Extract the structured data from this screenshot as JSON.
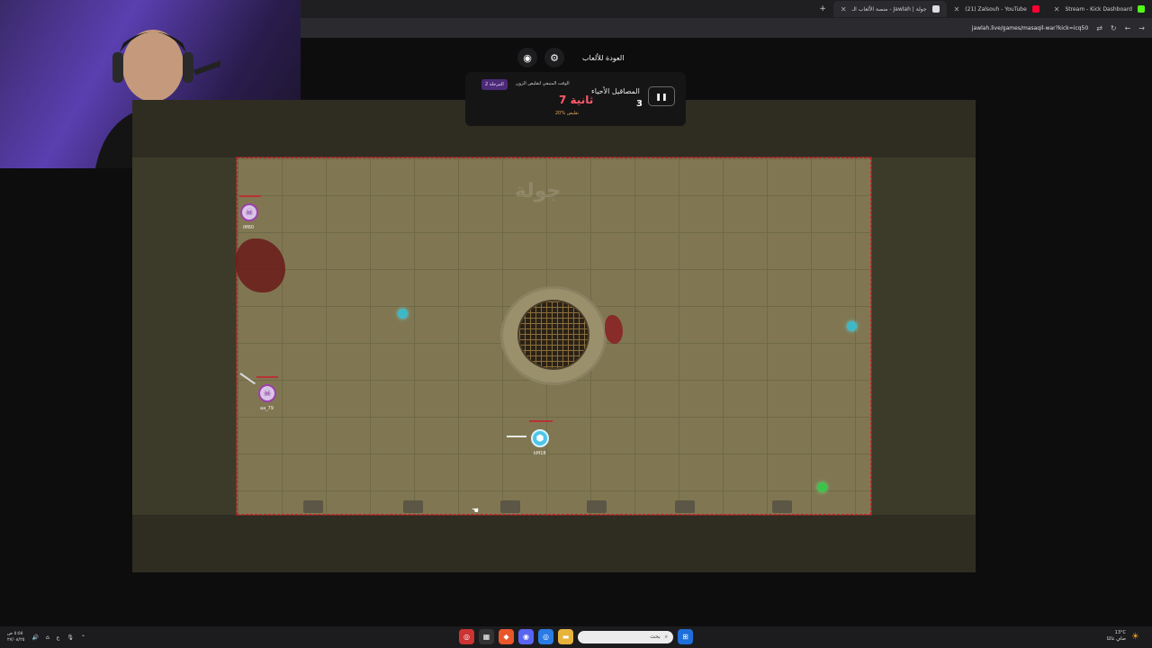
{
  "browser": {
    "tabs": [
      {
        "label": "Stream - Kick Dashboard",
        "color": "#53fc18"
      },
      {
        "label": "(21) Zalsouh - YouTube",
        "color": "#ff0033"
      },
      {
        "label": "منصة الألعاب الـ - Jawlah | جولة",
        "color": "#ffffff",
        "active": true
      }
    ],
    "new_tab": "+",
    "url": "jawlah.live/games/masaqil-war?kick=icq50"
  },
  "hud": {
    "back_link": "العودة للألعاب",
    "alive_label": "المصاقيل الأحياء",
    "alive_count": "3",
    "stage_badge": "المرحلة 2",
    "shrink_label": "الوقت المتبقي لتقليص الزون",
    "time_value": "7 ثانية",
    "shrink_pct": "20% تقليص"
  },
  "arena": {
    "watermark": "جولة",
    "players": [
      {
        "name": "iM60",
        "kind": "enemy"
      },
      {
        "name": "aa_79",
        "kind": "enemy"
      },
      {
        "name": "kM18",
        "kind": "me"
      }
    ],
    "zone_color": "#c8262b"
  },
  "taskbar": {
    "time": "٥:٥٥ ص",
    "date": "٢٧/٠٨/٢٥",
    "lang": "ع",
    "search_placeholder": "بحث",
    "temp": "13°C",
    "weather": "صافٍ غالبًا"
  }
}
